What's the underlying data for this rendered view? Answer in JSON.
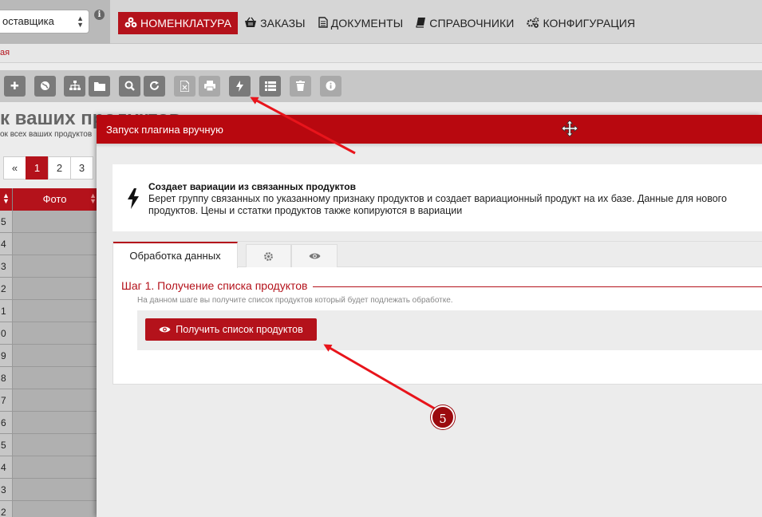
{
  "topbar": {
    "supplier_select": "оставщика",
    "nav": [
      {
        "icon": "cubes-icon",
        "label": "НОМЕНКЛАТУРА",
        "active": true
      },
      {
        "icon": "basket-icon",
        "label": "ЗАКАЗЫ",
        "active": false
      },
      {
        "icon": "document-icon",
        "label": "ДОКУМЕНТЫ",
        "active": false
      },
      {
        "icon": "book-icon",
        "label": "СПРАВОЧНИКИ",
        "active": false
      },
      {
        "icon": "cogs-icon",
        "label": "КОНФИГУРАЦИЯ",
        "active": false
      }
    ]
  },
  "breadcrumb": "ая",
  "toolbar": {
    "buttons": [
      "plus-icon",
      "globe-icon",
      "sitemap-icon",
      "folder-icon",
      "search-icon",
      "refresh-icon",
      "excel-icon",
      "print-icon",
      "bolt-icon",
      "list-icon",
      "trash-icon",
      "info-icon"
    ]
  },
  "background": {
    "title": "к ваших продуктов",
    "subtitle": "ок всех ваших продуктов",
    "pager": [
      "«",
      "1",
      "2",
      "3"
    ],
    "grid_header_photo": "Фото",
    "row_numbers": [
      "5",
      "4",
      "3",
      "2",
      "1",
      "0",
      "9",
      "8",
      "7",
      "6",
      "5",
      "4",
      "3",
      "2"
    ]
  },
  "modal": {
    "title": "Запуск плагина вручную",
    "plugin_title": "Создает вариации из связанных продуктов",
    "plugin_desc": "Берет группу связанных по указанному признаку продуктов и создает вариационный продукт на их базе. Данные для нового продуктов. Цены и сстатки продуктов также копируются в вариации",
    "tabs": {
      "data_processing": "Обработка данных"
    },
    "step_title": "Шаг 1. Получение списка продуктов",
    "step_hint": "На данном шаге вы получите список продуктов который будет подлежать обработке.",
    "get_list_button": "Получить список продуктов"
  },
  "annotation": {
    "badge": "5",
    "color": "#e8141b"
  },
  "colors": {
    "brand_red": "#b4121b"
  }
}
